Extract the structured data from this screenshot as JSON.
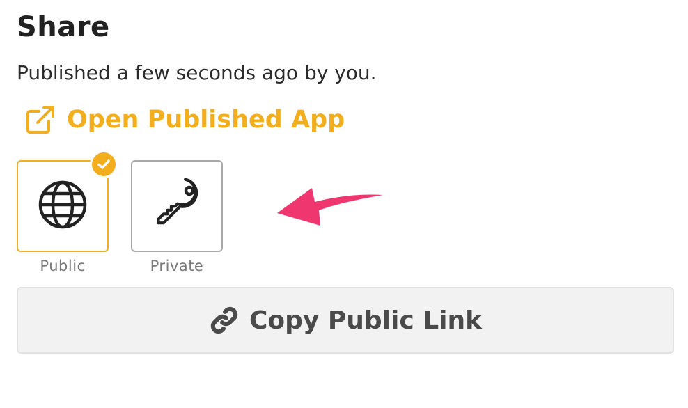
{
  "share": {
    "title": "Share",
    "status": "Published a few seconds ago by you.",
    "open_link": {
      "label": "Open Published App",
      "icon": "external-link-icon"
    },
    "visibility": {
      "selected": "Public",
      "options": [
        {
          "label": "Public",
          "icon": "globe-icon",
          "selected": true
        },
        {
          "label": "Private",
          "icon": "key-icon",
          "selected": false
        }
      ]
    },
    "copy_button": {
      "label": "Copy Public Link",
      "icon": "link-icon"
    }
  },
  "colors": {
    "accent": "#f2ae1c",
    "annotation_arrow": "#f0366e",
    "text": "#2b2b2b",
    "muted": "#7a7a7a",
    "button_bg": "#f2f2f2"
  }
}
